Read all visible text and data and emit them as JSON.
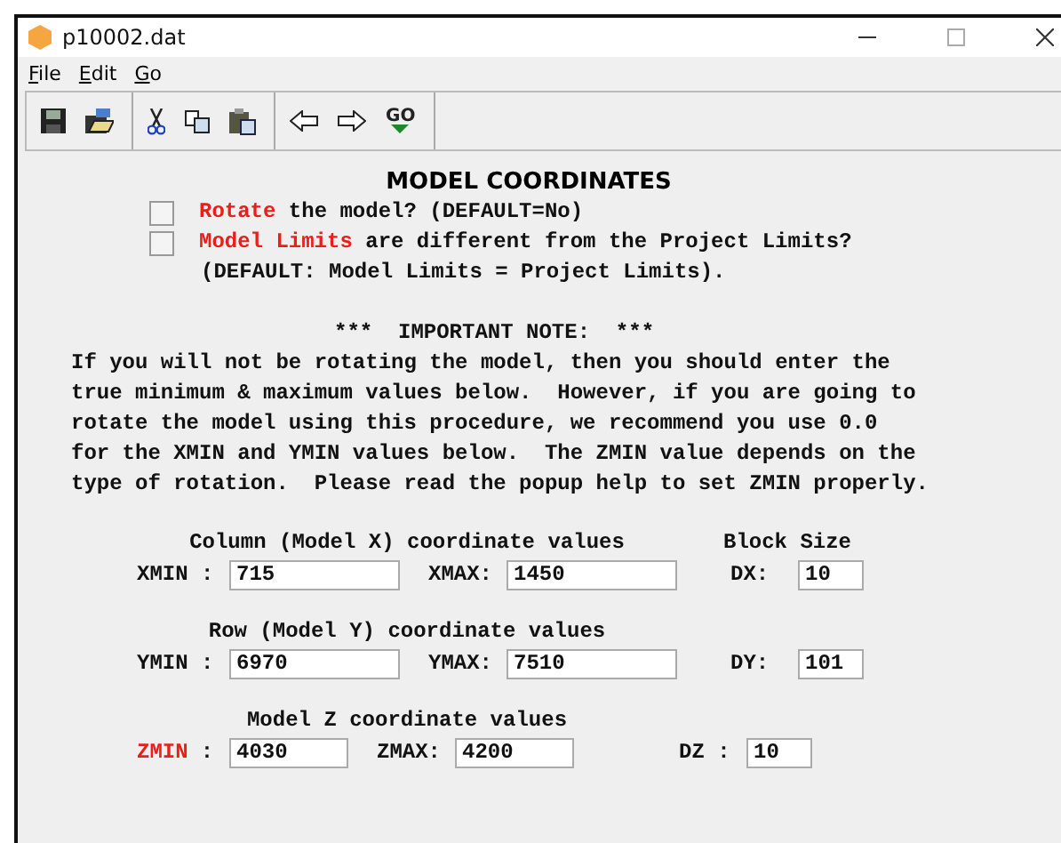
{
  "window": {
    "title": "p10002.dat"
  },
  "menu": [
    "File",
    "Edit",
    "Go"
  ],
  "toolbar": [
    [
      {
        "kind": "save"
      },
      {
        "kind": "open"
      }
    ],
    [
      {
        "kind": "cut"
      },
      {
        "kind": "copy"
      },
      {
        "kind": "paste"
      }
    ],
    [
      {
        "kind": "back"
      },
      {
        "kind": "forward"
      },
      {
        "kind": "go",
        "label": "GO"
      }
    ]
  ],
  "heading": "MODEL COORDINATES",
  "options": [
    {
      "highlight": "Rotate",
      "text": "the model? (DEFAULT=No)",
      "checked": false
    },
    {
      "highlight": "Model Limits",
      "text": "are different from the Project Limits?",
      "checked": false
    }
  ],
  "default_note": "(DEFAULT: Model Limits = Project Limits).",
  "note_title": "***  IMPORTANT NOTE:  ***",
  "note_lines": [
    "If you will not be rotating the model, then you should enter the",
    "true minimum & maximum values below.  However, if you are going to",
    "rotate the model using this procedure, we recommend you use 0.0",
    "for the XMIN and YMIN values below.  The ZMIN value depends on the",
    "type of rotation.  Please read the popup help to set ZMIN properly."
  ],
  "sections": [
    {
      "title": "Column (Model X) coordinate values",
      "block_title": "Block Size",
      "min_label": "XMIN :",
      "min_highlighted": false,
      "min": "715",
      "max_label": "XMAX:",
      "max": "1450",
      "size_label": "DX:",
      "size": "10"
    },
    {
      "title": "Row (Model Y) coordinate values",
      "min_label": "YMIN :",
      "min_highlighted": false,
      "min": "6970",
      "max_label": "YMAX:",
      "max": "7510",
      "size_label": "DY:",
      "size": "101"
    },
    {
      "title": "Model Z coordinate values",
      "min_label": "ZMIN",
      "min_label_suffix": ":",
      "min_highlighted": true,
      "min": "4030",
      "max_label": "ZMAX:",
      "max": "4200",
      "size_label": "DZ :",
      "size": "10"
    }
  ]
}
